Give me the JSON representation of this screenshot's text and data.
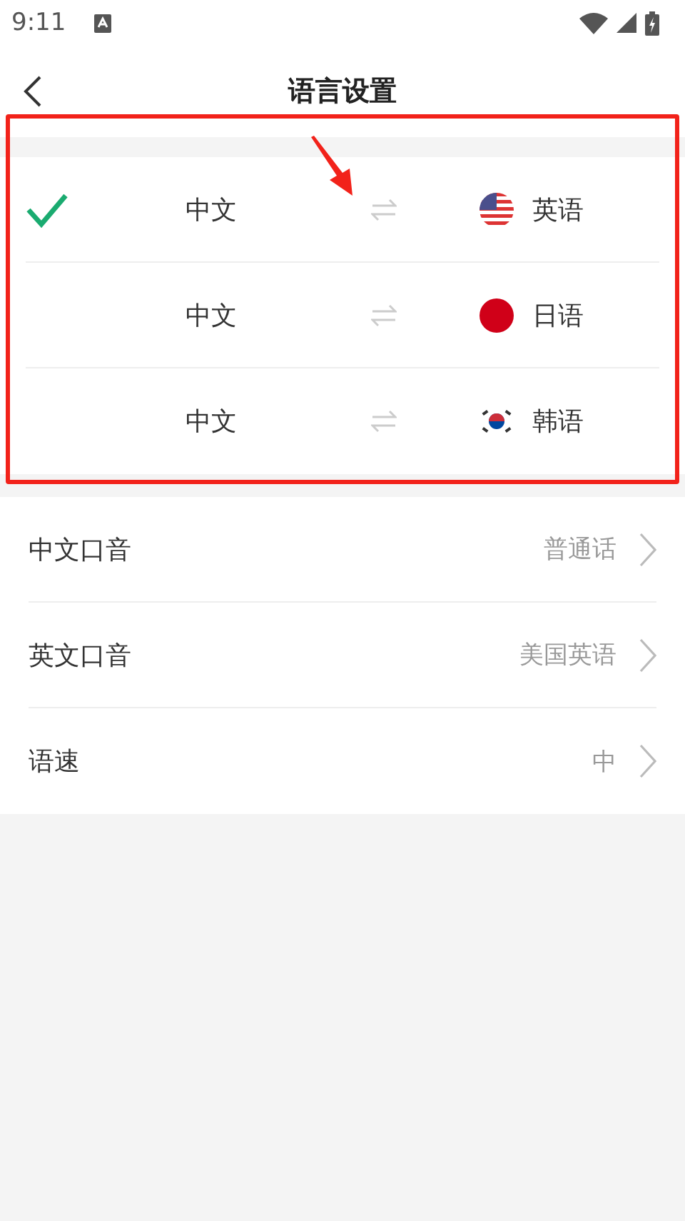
{
  "status_bar": {
    "time": "9:11"
  },
  "header": {
    "title": "语言设置"
  },
  "language_pairs": [
    {
      "source": "中文",
      "target": "英语",
      "kind": "us",
      "selected": true
    },
    {
      "source": "中文",
      "target": "日语",
      "kind": "jp",
      "selected": false
    },
    {
      "source": "中文",
      "target": "韩语",
      "kind": "kr",
      "selected": false
    }
  ],
  "settings": [
    {
      "label": "中文口音",
      "value": "普通话"
    },
    {
      "label": "英文口音",
      "value": "美国英语"
    },
    {
      "label": "语速",
      "value": "中"
    }
  ]
}
